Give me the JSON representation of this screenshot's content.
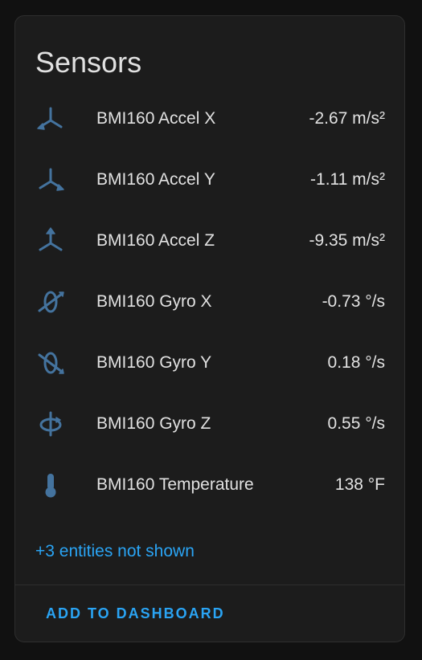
{
  "card": {
    "title": "Sensors",
    "more_link": "+3 entities not shown",
    "add_button": "ADD TO DASHBOARD"
  },
  "colors": {
    "icon": "#44739e",
    "accent": "#2aa4f4",
    "text": "#e1e1e1",
    "card_background": "#1c1c1c",
    "page_background": "#111111"
  },
  "entities": [
    {
      "name": "BMI160 Accel X",
      "value": "-2.67 m/s²",
      "icon": "axis-x-arrow-icon"
    },
    {
      "name": "BMI160 Accel Y",
      "value": "-1.11 m/s²",
      "icon": "axis-y-arrow-icon"
    },
    {
      "name": "BMI160 Accel Z",
      "value": "-9.35 m/s²",
      "icon": "axis-z-arrow-icon"
    },
    {
      "name": "BMI160 Gyro X",
      "value": "-0.73 °/s",
      "icon": "axis-x-rotate-icon"
    },
    {
      "name": "BMI160 Gyro Y",
      "value": "0.18 °/s",
      "icon": "axis-y-rotate-icon"
    },
    {
      "name": "BMI160 Gyro Z",
      "value": "0.55 °/s",
      "icon": "axis-z-rotate-icon"
    },
    {
      "name": "BMI160 Temperature",
      "value": "138 °F",
      "icon": "thermometer-icon"
    }
  ]
}
